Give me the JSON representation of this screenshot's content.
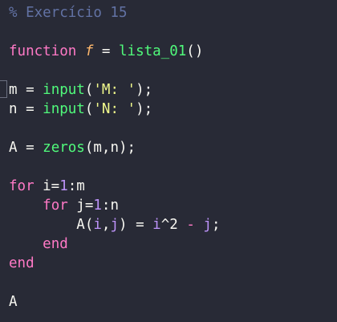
{
  "editor": {
    "lines": [
      [
        {
          "t": "% Exercício 15",
          "c": "comment"
        }
      ],
      [],
      [
        {
          "t": "function",
          "c": "keyword"
        },
        {
          "t": " ",
          "c": "plain"
        },
        {
          "t": "f",
          "c": "param"
        },
        {
          "t": " = ",
          "c": "plain"
        },
        {
          "t": "lista_01",
          "c": "fn"
        },
        {
          "t": "()",
          "c": "plain"
        }
      ],
      [],
      [
        {
          "t": "m = ",
          "c": "plain"
        },
        {
          "t": "input",
          "c": "fn"
        },
        {
          "t": "(",
          "c": "plain"
        },
        {
          "t": "'M: '",
          "c": "string"
        },
        {
          "t": ");",
          "c": "plain"
        }
      ],
      [
        {
          "t": "n = ",
          "c": "plain"
        },
        {
          "t": "input",
          "c": "fn"
        },
        {
          "t": "(",
          "c": "plain"
        },
        {
          "t": "'N: '",
          "c": "string"
        },
        {
          "t": ");",
          "c": "plain"
        }
      ],
      [],
      [
        {
          "t": "A = ",
          "c": "plain"
        },
        {
          "t": "zeros",
          "c": "fn"
        },
        {
          "t": "(m,n);",
          "c": "plain"
        }
      ],
      [],
      [
        {
          "t": "for",
          "c": "keyword"
        },
        {
          "t": " i=",
          "c": "plain"
        },
        {
          "t": "1",
          "c": "number"
        },
        {
          "t": ":m",
          "c": "plain"
        }
      ],
      [
        {
          "t": "    ",
          "c": "plain"
        },
        {
          "t": "for",
          "c": "keyword"
        },
        {
          "t": " j=",
          "c": "plain"
        },
        {
          "t": "1",
          "c": "number"
        },
        {
          "t": ":n",
          "c": "plain"
        }
      ],
      [
        {
          "t": "        A(",
          "c": "plain"
        },
        {
          "t": "i",
          "c": "var"
        },
        {
          "t": ",",
          "c": "plain"
        },
        {
          "t": "j",
          "c": "var"
        },
        {
          "t": ") = ",
          "c": "plain"
        },
        {
          "t": "i",
          "c": "var"
        },
        {
          "t": "^2 ",
          "c": "plain"
        },
        {
          "t": "-",
          "c": "op"
        },
        {
          "t": " ",
          "c": "plain"
        },
        {
          "t": "j",
          "c": "var"
        },
        {
          "t": ";",
          "c": "plain"
        }
      ],
      [
        {
          "t": "    ",
          "c": "plain"
        },
        {
          "t": "end",
          "c": "keyword"
        }
      ],
      [
        {
          "t": "end",
          "c": "keyword"
        }
      ],
      [],
      [
        {
          "t": "A",
          "c": "plain"
        }
      ]
    ]
  }
}
